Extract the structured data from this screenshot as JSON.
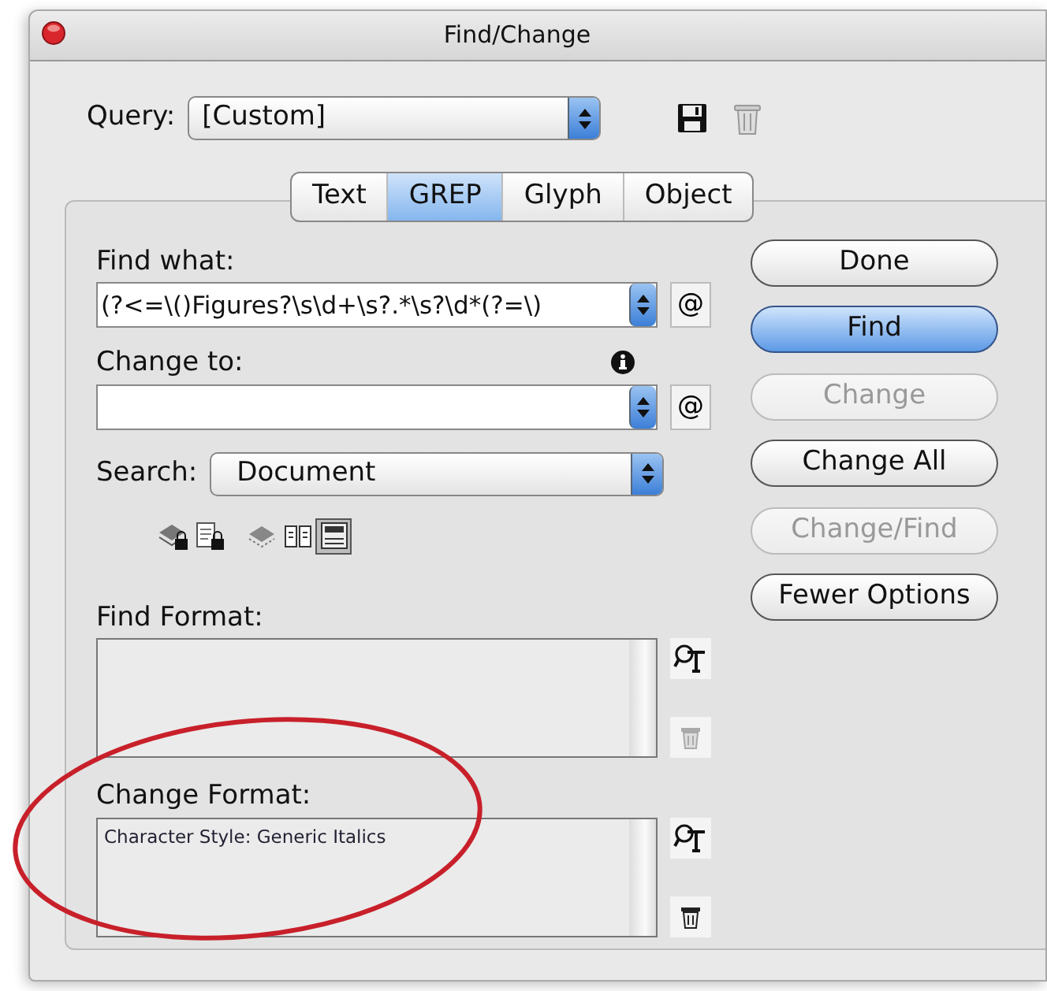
{
  "window": {
    "title": "Find/Change"
  },
  "query": {
    "label": "Query:",
    "value": "[Custom]"
  },
  "tabs": [
    {
      "label": "Text",
      "selected": false
    },
    {
      "label": "GREP",
      "selected": true
    },
    {
      "label": "Glyph",
      "selected": false
    },
    {
      "label": "Object",
      "selected": false
    }
  ],
  "find_what": {
    "label": "Find what:",
    "value": "(?<=\\()Figures?\\s\\d+\\s?.*\\s?\\d*(?=\\)",
    "menu_button": "@"
  },
  "change_to": {
    "label": "Change to:",
    "menu_button": "@"
  },
  "search": {
    "label": "Search:",
    "value": "Document"
  },
  "search_options": [
    {
      "kind": "layers-lock",
      "selected": false
    },
    {
      "kind": "page-lock",
      "selected": false
    },
    {
      "kind": "layers",
      "selected": false
    },
    {
      "kind": "book",
      "selected": false
    },
    {
      "kind": "panel",
      "selected": true
    }
  ],
  "find_format": {
    "label": "Find Format:",
    "trash_disabled": true
  },
  "change_format": {
    "label": "Change Format:",
    "text": "Character Style: Generic Italics",
    "trash_disabled": false
  },
  "buttons": [
    {
      "label": "Done",
      "default": false,
      "disabled": false
    },
    {
      "label": "Find",
      "default": true,
      "disabled": false
    },
    {
      "label": "Change",
      "default": false,
      "disabled": true
    },
    {
      "label": "Change All",
      "default": false,
      "disabled": false
    },
    {
      "label": "Change/Find",
      "default": false,
      "disabled": true
    },
    {
      "label": "Fewer Options",
      "default": false,
      "disabled": false
    }
  ],
  "annotation": {
    "kind": "ellipse",
    "color": "#c8202a"
  }
}
